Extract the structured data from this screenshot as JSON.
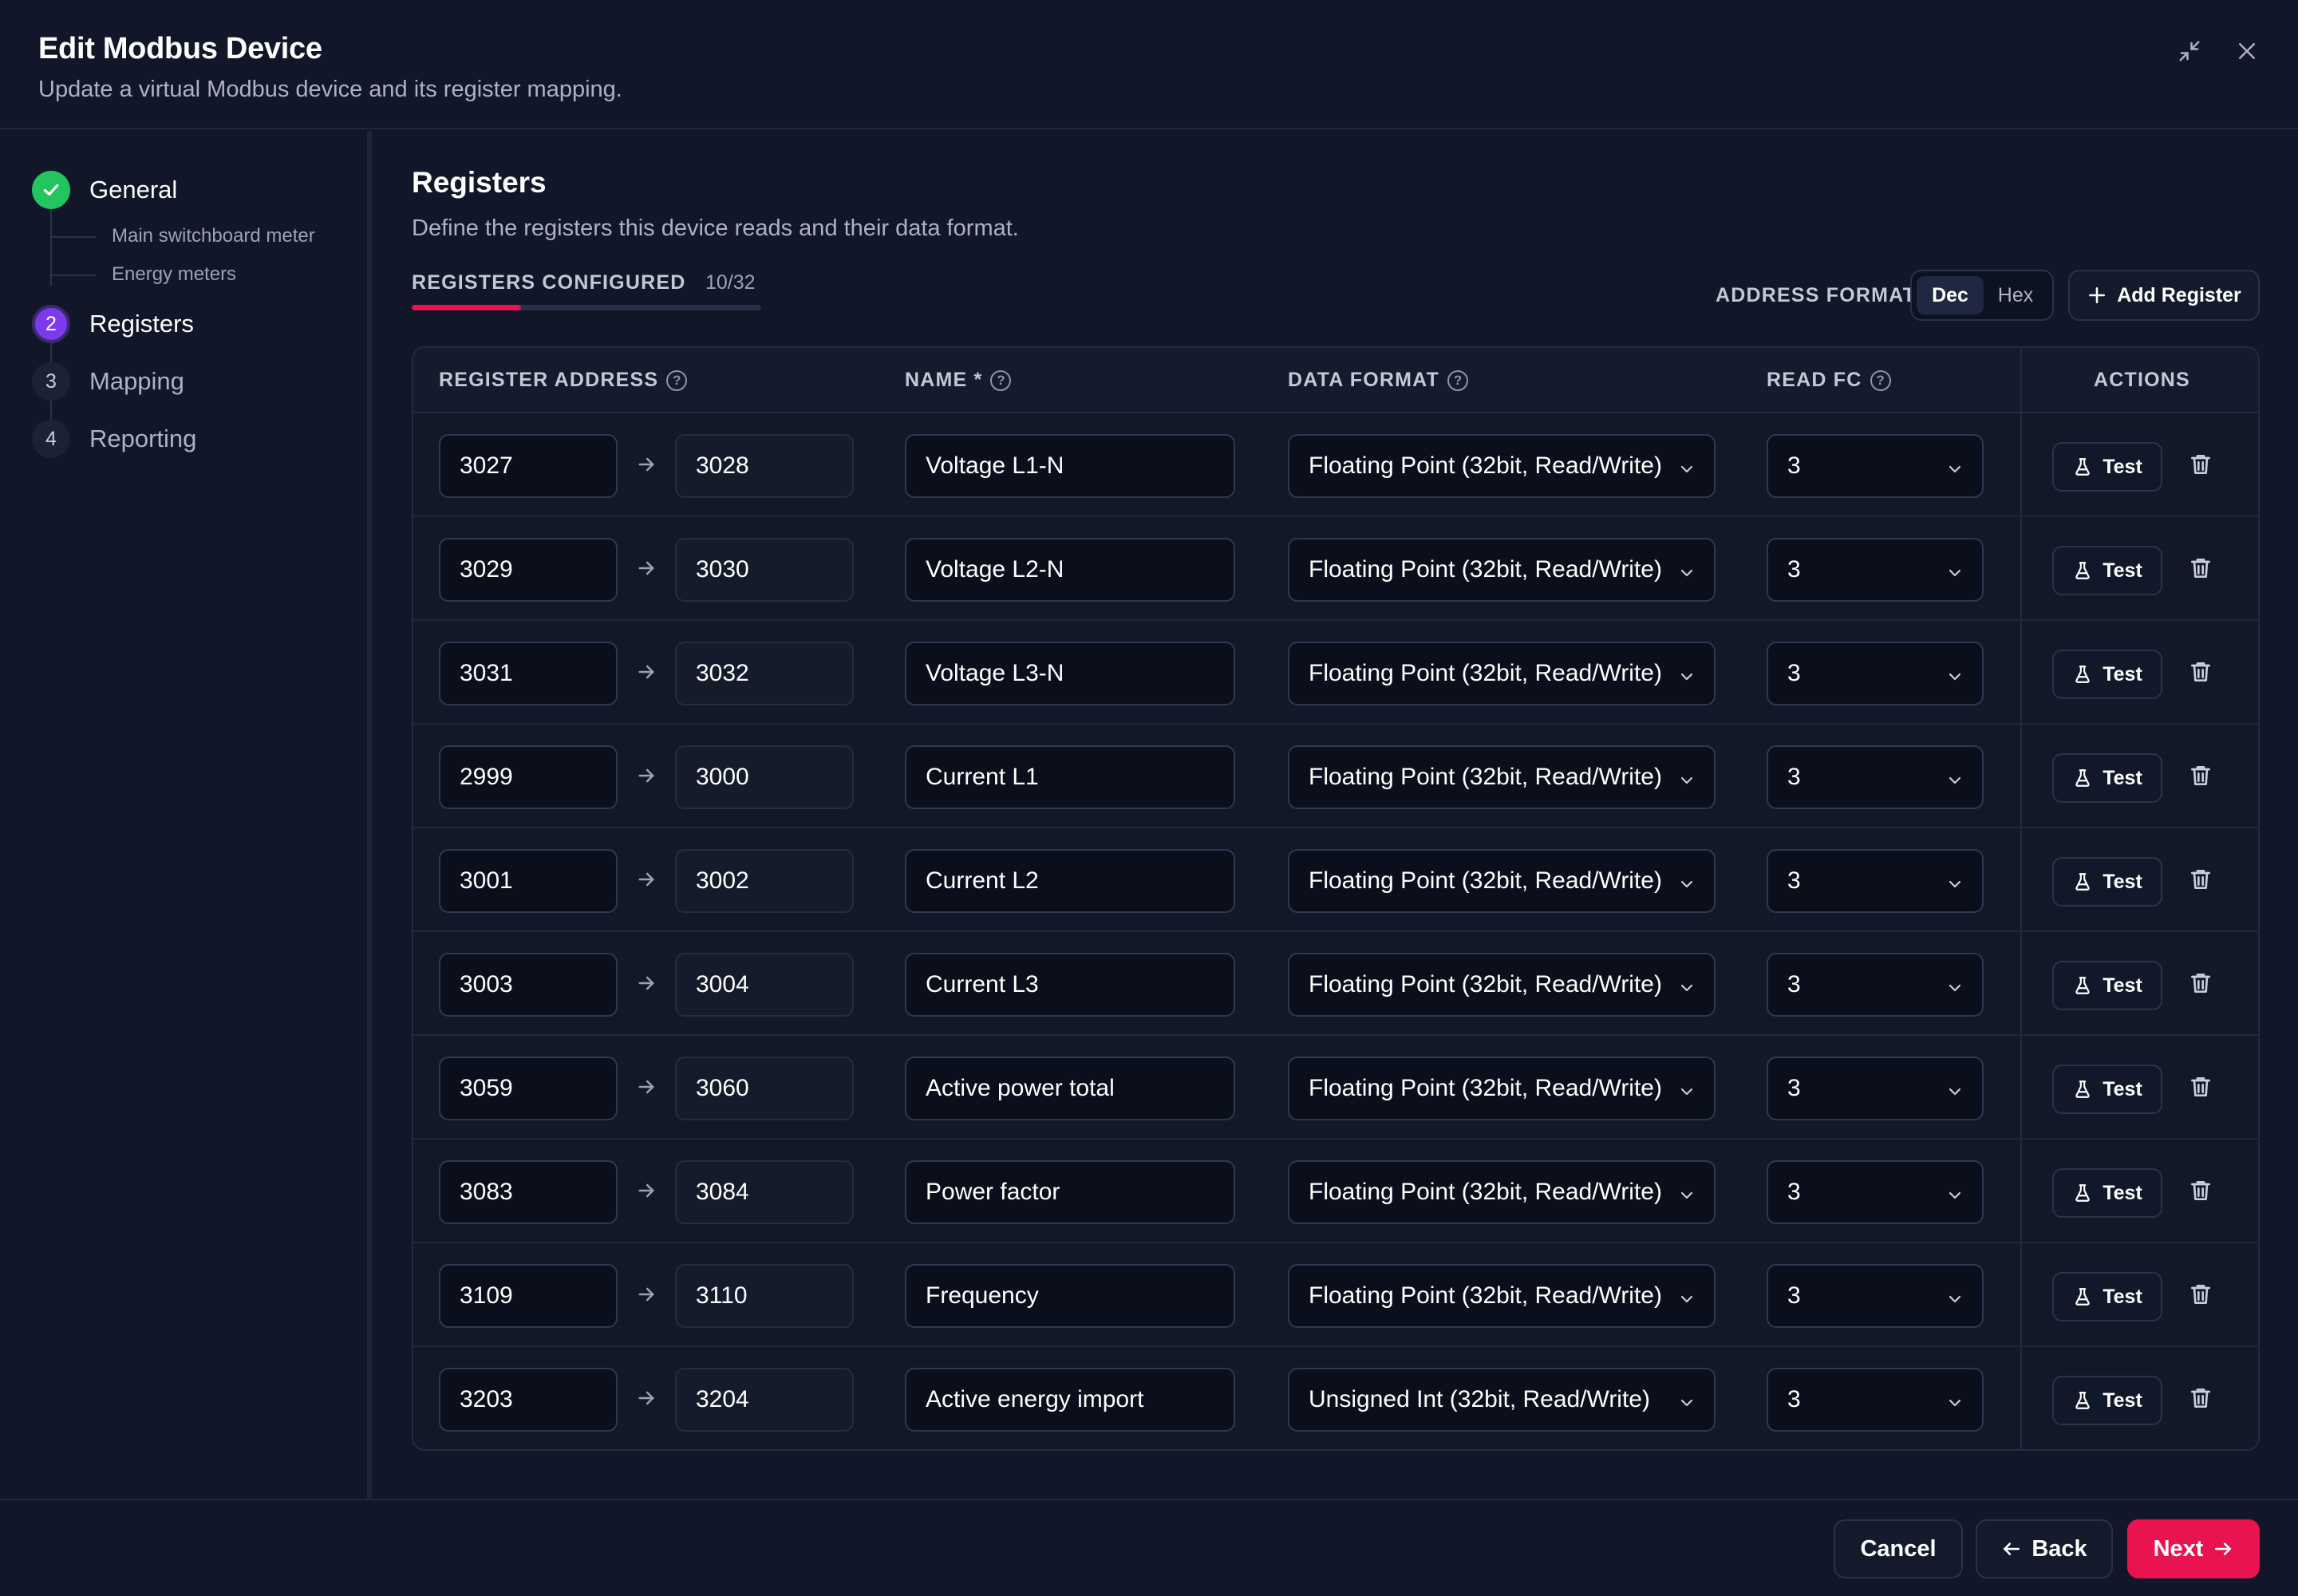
{
  "header": {
    "title": "Edit Modbus Device",
    "subtitle": "Update a virtual Modbus device and its register mapping."
  },
  "sidebar": {
    "steps": [
      {
        "number": "",
        "label": "General",
        "state": "done",
        "subitems": [
          "Main switchboard meter",
          "Energy meters"
        ]
      },
      {
        "number": "2",
        "label": "Registers",
        "state": "active"
      },
      {
        "number": "3",
        "label": "Mapping",
        "state": "pending"
      },
      {
        "number": "4",
        "label": "Reporting",
        "state": "pending"
      }
    ]
  },
  "main": {
    "title": "Registers",
    "description": "Define the registers this device reads and their data format.",
    "registers_configured_label": "REGISTERS CONFIGURED",
    "registers_configured_count": "10/32",
    "registers_configured_fraction": 0.3125,
    "address_format_label": "ADDRESS FORMAT",
    "address_format_options": [
      "Dec",
      "Hex"
    ],
    "address_format_selected": "Dec",
    "add_register_label": "Add Register"
  },
  "table": {
    "columns": {
      "address": "REGISTER ADDRESS",
      "name": "NAME *",
      "format": "DATA FORMAT",
      "fc": "READ FC",
      "actions": "ACTIONS"
    },
    "test_label": "Test",
    "rows": [
      {
        "start": "3027",
        "end": "3028",
        "name": "Voltage L1-N",
        "format": "Floating Point (32bit, Read/Write)",
        "fc": "3"
      },
      {
        "start": "3029",
        "end": "3030",
        "name": "Voltage L2-N",
        "format": "Floating Point (32bit, Read/Write)",
        "fc": "3"
      },
      {
        "start": "3031",
        "end": "3032",
        "name": "Voltage L3-N",
        "format": "Floating Point (32bit, Read/Write)",
        "fc": "3"
      },
      {
        "start": "2999",
        "end": "3000",
        "name": "Current L1",
        "format": "Floating Point (32bit, Read/Write)",
        "fc": "3"
      },
      {
        "start": "3001",
        "end": "3002",
        "name": "Current L2",
        "format": "Floating Point (32bit, Read/Write)",
        "fc": "3"
      },
      {
        "start": "3003",
        "end": "3004",
        "name": "Current L3",
        "format": "Floating Point (32bit, Read/Write)",
        "fc": "3"
      },
      {
        "start": "3059",
        "end": "3060",
        "name": "Active power total",
        "format": "Floating Point (32bit, Read/Write)",
        "fc": "3"
      },
      {
        "start": "3083",
        "end": "3084",
        "name": "Power factor",
        "format": "Floating Point (32bit, Read/Write)",
        "fc": "3"
      },
      {
        "start": "3109",
        "end": "3110",
        "name": "Frequency",
        "format": "Floating Point (32bit, Read/Write)",
        "fc": "3"
      },
      {
        "start": "3203",
        "end": "3204",
        "name": "Active energy import",
        "format": "Unsigned Int (32bit, Read/Write)",
        "fc": "3"
      }
    ]
  },
  "footer": {
    "cancel_label": "Cancel",
    "back_label": "Back",
    "next_label": "Next"
  },
  "colors": {
    "accent": "#e8134f",
    "step_done": "#22c55e",
    "step_active": "#7c3aed",
    "background": "#111729"
  },
  "icons": [
    "minimize-icon",
    "close-icon",
    "check-icon",
    "help-icon",
    "arrow-right-icon",
    "chevron-down-icon",
    "flask-icon",
    "trash-icon",
    "plus-icon",
    "arrow-left-icon"
  ]
}
